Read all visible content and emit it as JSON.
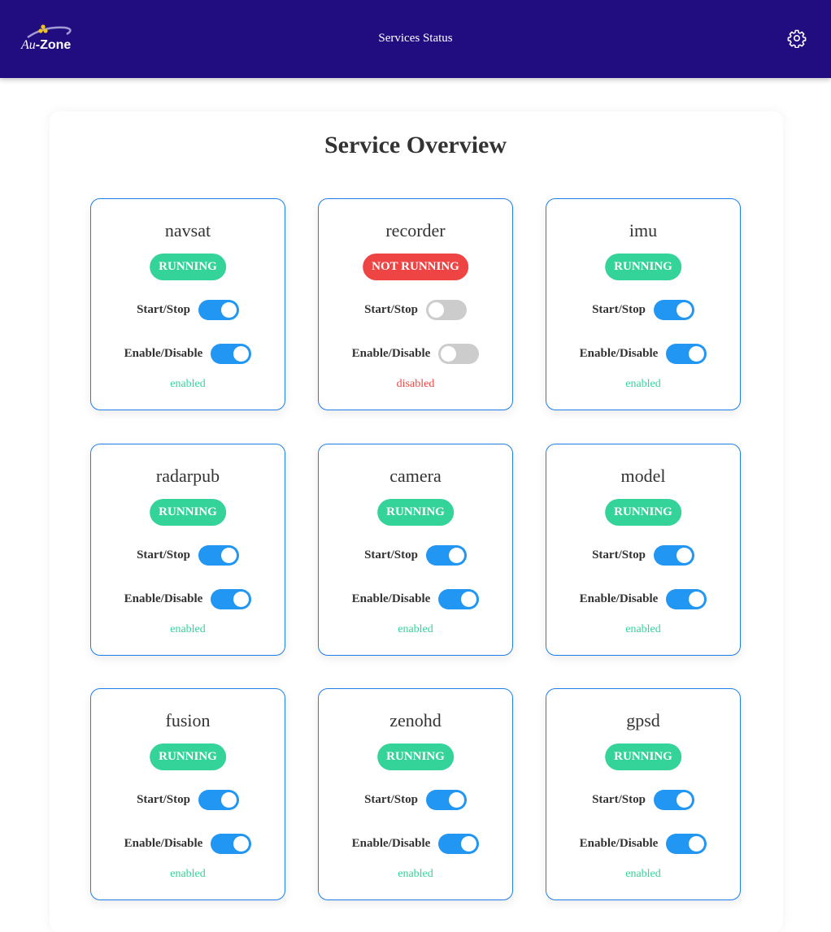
{
  "header": {
    "logo_au": "Au",
    "logo_zone": "-Zone",
    "title": "Services Status",
    "settings_icon": "gear-icon"
  },
  "main": {
    "title": "Service Overview"
  },
  "labels": {
    "start_stop": "Start/Stop",
    "enable_disable": "Enable/Disable"
  },
  "colors": {
    "header_bg": "#220d80",
    "running": "#34d399",
    "not_running": "#ef4444",
    "toggle_on": "#2196f3",
    "toggle_off": "#cccccc",
    "enabled_text": "#34d399",
    "disabled_text": "#ef4444",
    "card_border": "#1e7ee8"
  },
  "services": [
    {
      "name": "navsat",
      "status": "RUNNING",
      "running": true,
      "enabled": true,
      "state_text": "enabled"
    },
    {
      "name": "recorder",
      "status": "NOT RUNNING",
      "running": false,
      "enabled": false,
      "state_text": "disabled"
    },
    {
      "name": "imu",
      "status": "RUNNING",
      "running": true,
      "enabled": true,
      "state_text": "enabled"
    },
    {
      "name": "radarpub",
      "status": "RUNNING",
      "running": true,
      "enabled": true,
      "state_text": "enabled"
    },
    {
      "name": "camera",
      "status": "RUNNING",
      "running": true,
      "enabled": true,
      "state_text": "enabled"
    },
    {
      "name": "model",
      "status": "RUNNING",
      "running": true,
      "enabled": true,
      "state_text": "enabled"
    },
    {
      "name": "fusion",
      "status": "RUNNING",
      "running": true,
      "enabled": true,
      "state_text": "enabled"
    },
    {
      "name": "zenohd",
      "status": "RUNNING",
      "running": true,
      "enabled": true,
      "state_text": "enabled"
    },
    {
      "name": "gpsd",
      "status": "RUNNING",
      "running": true,
      "enabled": true,
      "state_text": "enabled"
    }
  ]
}
